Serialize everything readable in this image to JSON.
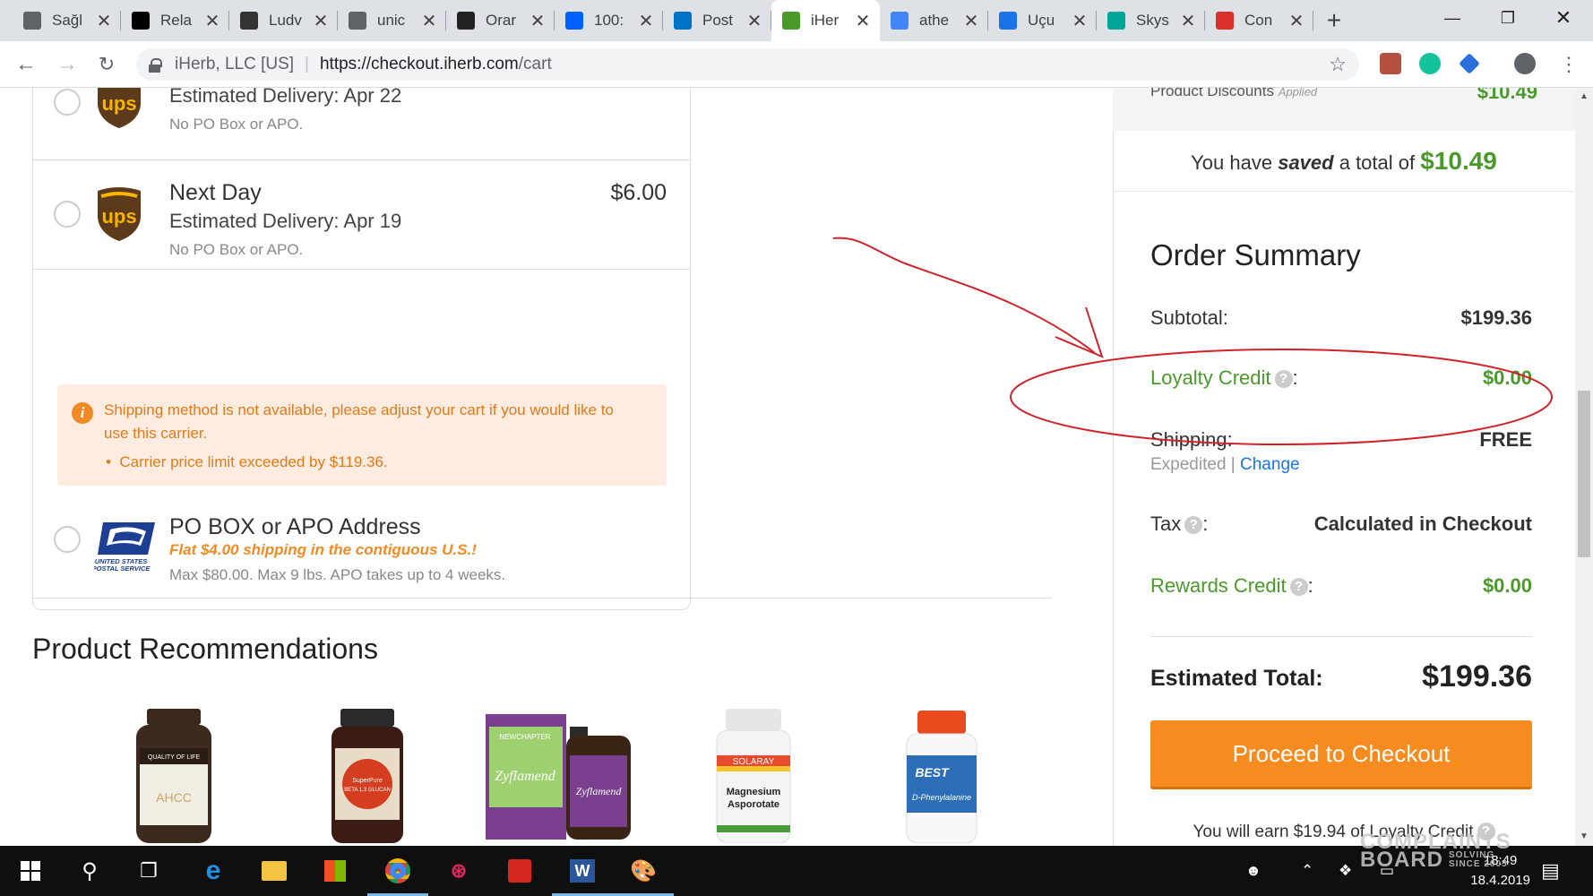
{
  "browser": {
    "tabs": [
      {
        "title": "Sağl",
        "icon": "document-icon",
        "color": "#5f6368"
      },
      {
        "title": "Rela",
        "icon": "wikipedia-icon",
        "color": "#000000"
      },
      {
        "title": "Ludv",
        "icon": "keyboard-icon",
        "color": "#333333"
      },
      {
        "title": "unic",
        "icon": "document-icon",
        "color": "#5f6368"
      },
      {
        "title": "Orar",
        "icon": "play-icon",
        "color": "#222222"
      },
      {
        "title": "100:",
        "icon": "dropbox-icon",
        "color": "#0061ff"
      },
      {
        "title": "Post",
        "icon": "outlook-icon",
        "color": "#0072c6"
      },
      {
        "title": "iHer",
        "icon": "iherb-leaf-icon",
        "color": "#4a9a2a"
      },
      {
        "title": "athe",
        "icon": "google-icon",
        "color": "#4285f4"
      },
      {
        "title": "Uçu",
        "icon": "plane-icon",
        "color": "#1a73e8"
      },
      {
        "title": "Skys",
        "icon": "skyscanner-icon",
        "color": "#00a698"
      },
      {
        "title": "Con",
        "icon": "shield-icon",
        "color": "#d9302c"
      }
    ],
    "active_tab_index": 7,
    "site_identity": "iHerb, LLC [US]",
    "url_main": "https://checkout.iherb.com",
    "url_path": "/cart"
  },
  "shipping": {
    "option1": {
      "date": "Estimated Delivery: Apr 22",
      "note": "No PO Box or APO."
    },
    "option2": {
      "name": "Next Day",
      "price": "$6.00",
      "date": "Estimated Delivery: Apr 19",
      "note": "No PO Box or APO."
    },
    "warning": {
      "text": "Shipping method is not available, please adjust your cart if you would like to use this carrier.",
      "bullet": "Carrier price limit exceeded by $119.36."
    },
    "option3": {
      "name": "PO BOX or APO Address",
      "promo": "Flat $4.00 shipping in the contiguous U.S.!",
      "note": "Max $80.00. Max 9 lbs. APO takes up to 4 weeks."
    }
  },
  "recommendations": {
    "title": "Product Recommendations"
  },
  "summary": {
    "top_label": "Product Discounts",
    "top_applied": "Applied",
    "top_value": "$10.49",
    "saved_prefix": "You have",
    "saved_word": "saved",
    "saved_middle": "a total of",
    "saved_amount": "$10.49",
    "title": "Order Summary",
    "subtotal_label": "Subtotal:",
    "subtotal_value": "$199.36",
    "loyalty_label": "Loyalty Credit",
    "loyalty_value": "$0.00",
    "shipping_label": "Shipping:",
    "shipping_value": "FREE",
    "shipping_method": "Expedited",
    "shipping_sep": "|",
    "shipping_change": "Change",
    "tax_label": "Tax",
    "tax_value": "Calculated in Checkout",
    "rewards_label": "Rewards Credit",
    "rewards_value": "$0.00",
    "total_label": "Estimated Total:",
    "total_value": "$199.36",
    "checkout_button": "Proceed to Checkout",
    "earn_text": "You will earn $19.94 of Loyalty Credit",
    "colon": ":",
    "help": "?"
  },
  "taskbar": {
    "time": "18:49",
    "date": "18.4.2019"
  },
  "watermark": {
    "line1": "COMPLAINTS",
    "line2": "BOARD",
    "tag1": "SOLVING",
    "tag2": "SINCE 2005"
  },
  "colors": {
    "accent_green": "#4a9a2a",
    "checkout_orange": "#f68b1f",
    "link_blue": "#1a73e8",
    "annotation_red": "#d0222a"
  }
}
